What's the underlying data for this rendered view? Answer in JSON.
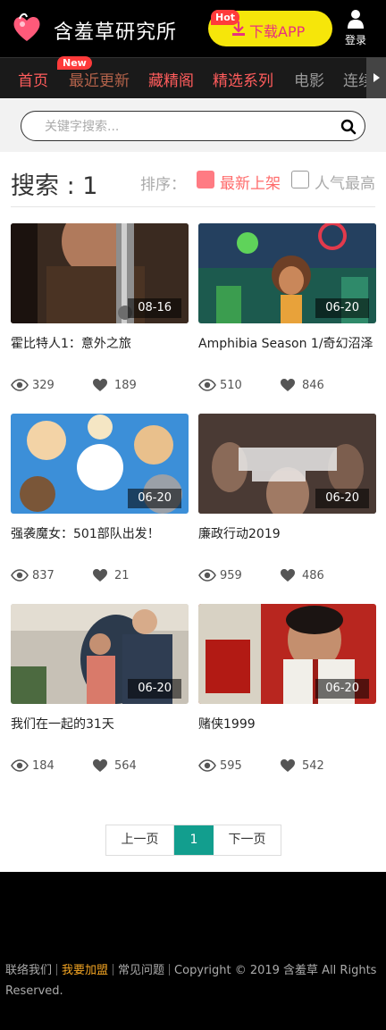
{
  "header": {
    "brand": "含羞草研究所",
    "hot_badge": "Hot",
    "download_label": "下载APP",
    "login_label": "登录",
    "accent": "#f6e60a"
  },
  "nav": {
    "new_badge": "New",
    "items": [
      {
        "label": "首页"
      },
      {
        "label": "最近更新"
      },
      {
        "label": "藏精阁"
      },
      {
        "label": "精选系列"
      },
      {
        "label": "电影"
      },
      {
        "label": "连续"
      }
    ]
  },
  "search": {
    "placeholder": "关键字搜索..."
  },
  "results": {
    "title": "搜索 : 1",
    "sort_label": "排序：",
    "sort_options": [
      {
        "label": "最新上架",
        "selected": true
      },
      {
        "label": "人气最高",
        "selected": false
      }
    ]
  },
  "videos": [
    {
      "title": "霍比特人1：意外之旅",
      "date": "08-16",
      "views": "329",
      "likes": "189"
    },
    {
      "title": "Amphibia Season 1/奇幻沼泽",
      "date": "06-20",
      "views": "510",
      "likes": "846"
    },
    {
      "title": "强袭魔女：501部队出发！",
      "date": "06-20",
      "views": "837",
      "likes": "21"
    },
    {
      "title": "廉政行动2019",
      "date": "06-20",
      "views": "959",
      "likes": "486"
    },
    {
      "title": "我们在一起的31天",
      "date": "06-20",
      "views": "184",
      "likes": "564"
    },
    {
      "title": "赌侠1999",
      "date": "06-20",
      "views": "595",
      "likes": "542"
    }
  ],
  "pagination": {
    "prev": "上一页",
    "current": "1",
    "next": "下一页"
  },
  "footer": {
    "links": [
      "联络我们",
      "我要加盟",
      "常见问题"
    ],
    "copyright": "Copyright © 2019 含羞草 All Rights Reserved."
  }
}
